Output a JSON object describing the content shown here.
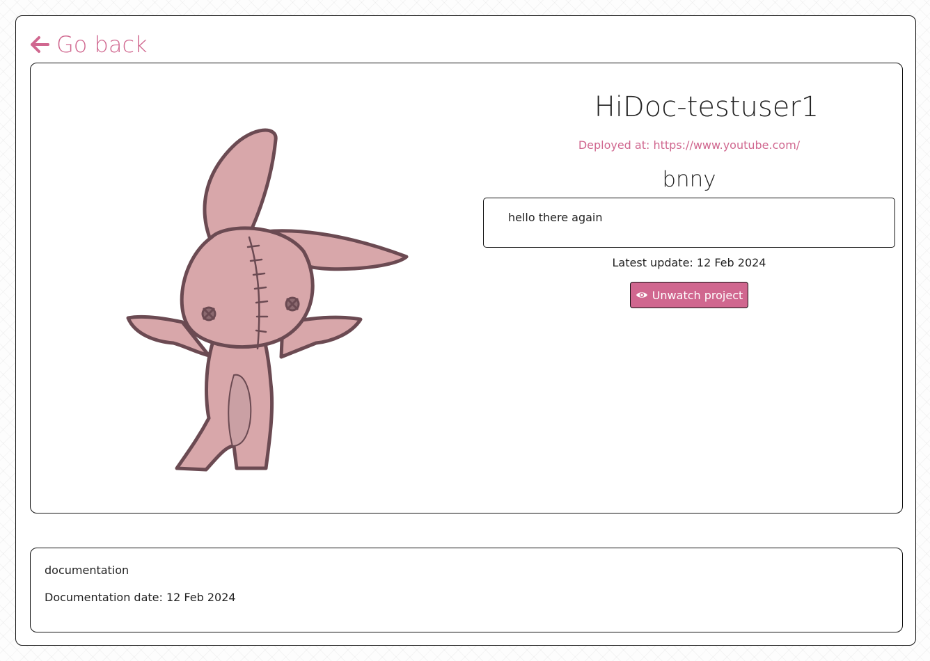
{
  "nav": {
    "go_back_label": "Go back"
  },
  "project": {
    "owner_title": "HiDoc-testuser1",
    "deployed_label": "Deployed at: https://www.youtube.com/",
    "name": "bnny",
    "description": "hello there again",
    "latest_update": "Latest update: 12 Feb 2024",
    "unwatch_label": "Unwatch project"
  },
  "documentation": {
    "title": "documentation",
    "date": "Documentation date: 12 Feb 2024"
  },
  "icons": {
    "back": "arrow-left-icon",
    "eye": "eye-icon"
  },
  "colors": {
    "accent": "#d0678f",
    "bunny_fill": "#d8a7aa",
    "bunny_stroke": "#6b4a52"
  }
}
